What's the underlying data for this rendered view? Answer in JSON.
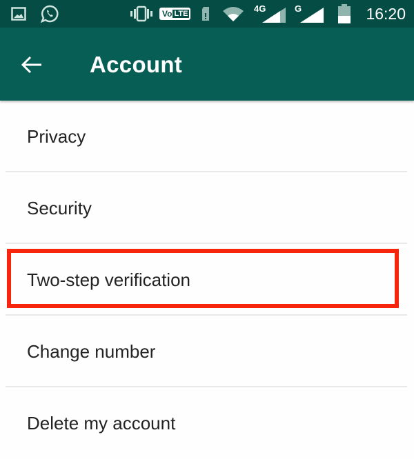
{
  "status_bar": {
    "icons": [
      "gallery-icon",
      "whatsapp-icon",
      "vibrate-icon",
      "volte-icon",
      "sd-card-icon",
      "wifi-icon",
      "signal-4g-icon",
      "signal-g-icon",
      "battery-icon"
    ],
    "volte_label_a": "Vo",
    "volte_label_b": "LTE",
    "net1": "4G",
    "net2": "G",
    "time": "16:20"
  },
  "app_bar": {
    "title": "Account",
    "back_icon": "arrow-left-icon",
    "color": "#075e54"
  },
  "menu": {
    "items": [
      {
        "label": "Privacy"
      },
      {
        "label": "Security"
      },
      {
        "label": "Two-step verification",
        "highlighted": true
      },
      {
        "label": "Change number"
      },
      {
        "label": "Delete my account"
      }
    ]
  },
  "highlight_color": "#f7250c"
}
